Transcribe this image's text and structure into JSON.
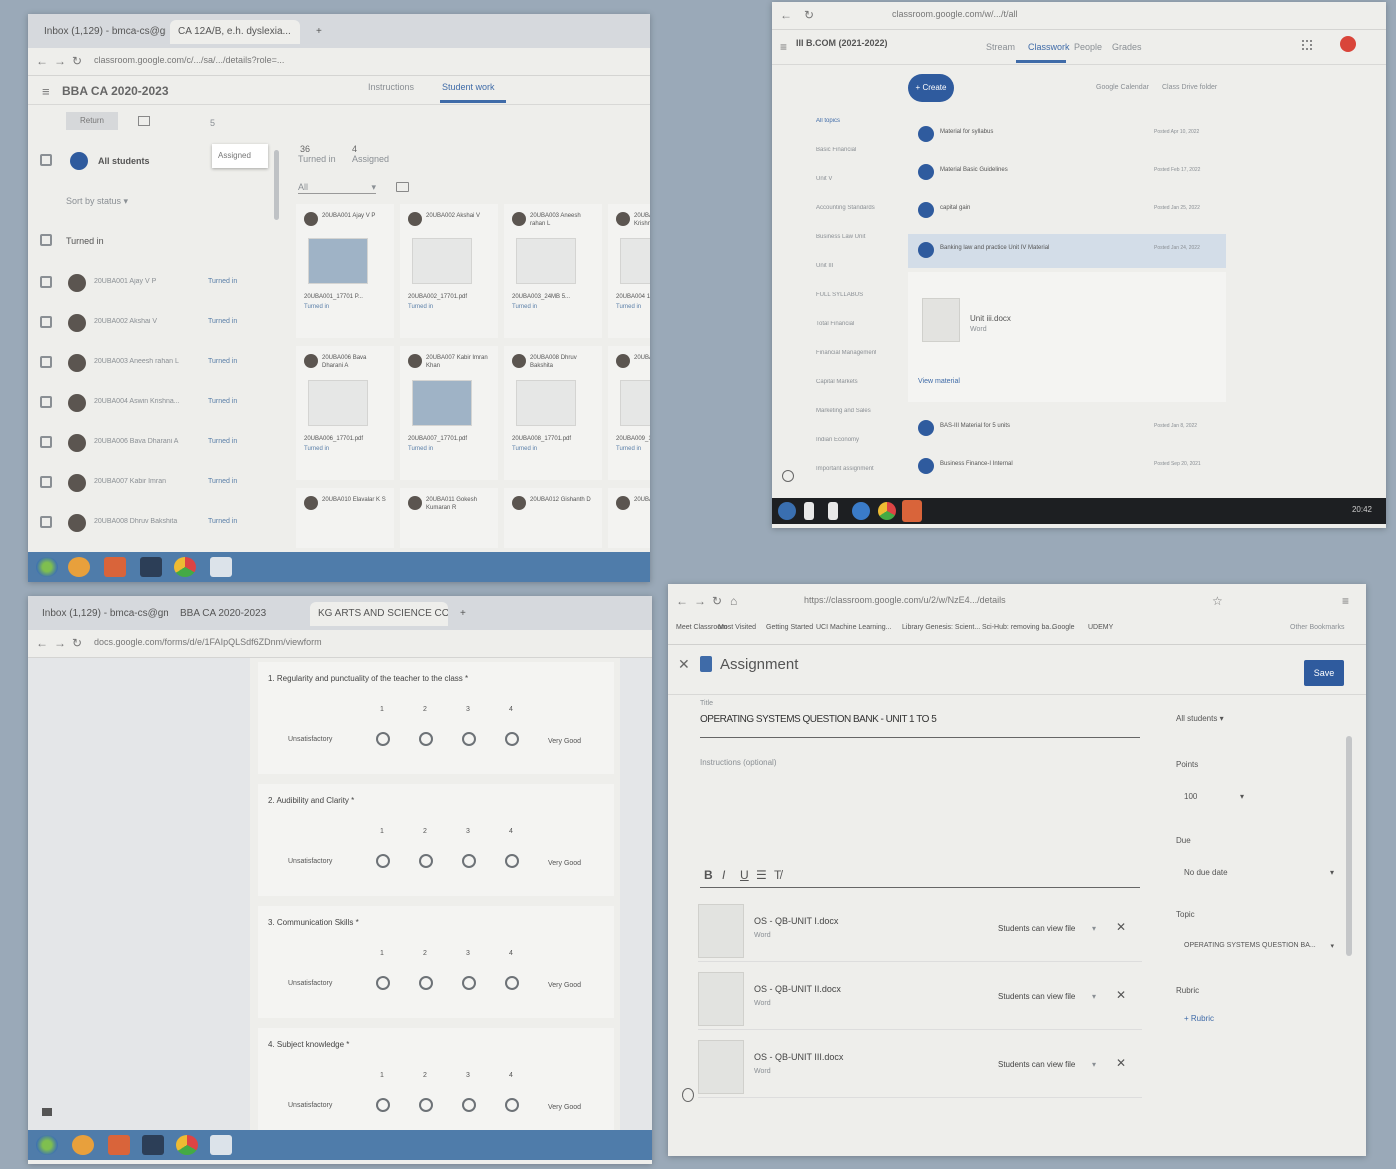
{
  "w1": {
    "tabs": [
      "Inbox (1,129) - bmca-cs@gm...",
      "CA 12A/B, e.h. dyslexia...",
      "+"
    ],
    "url": "classroom.google.com/c/.../sa/.../details?role=...",
    "class_title": "BBA CA 2020-2023",
    "tabs_nav": [
      "Instructions",
      "Student work"
    ],
    "return_label": "Return",
    "assigned_badge": "Assigned",
    "all_students": "All students",
    "sort_label": "Sort by status",
    "turned_in_group": "Turned in",
    "counts": {
      "turned_label": "Turned in",
      "assigned_label": "Assigned",
      "turned_count": "36",
      "assigned_count": "4"
    },
    "filter_all": "All",
    "students": [
      {
        "name": "20UBA001 Ajay V P",
        "status": "Turned in"
      },
      {
        "name": "20UBA002 Akshai V",
        "status": "Turned in"
      },
      {
        "name": "20UBA003 Aneesh rahan L",
        "status": "Turned in"
      },
      {
        "name": "20UBA004 Aswin Krishna...",
        "status": "Turned in"
      },
      {
        "name": "20UBA006 Bava Dharani A",
        "status": "Turned in"
      },
      {
        "name": "20UBA007 Kabir Imran",
        "status": "Turned in"
      },
      {
        "name": "20UBA008 Dhruv Bakshita",
        "status": "Turned in"
      }
    ],
    "grid": [
      {
        "name": "20UBA001 Ajay V P",
        "file": "20UBA001_17701 P...",
        "status": "Turned in"
      },
      {
        "name": "20UBA002 Akshai V",
        "file": "20UBA002_17701.pdf",
        "status": "Turned in"
      },
      {
        "name": "20UBA003 Aneesh rahan L",
        "file": "20UBA003_24MB 5...",
        "status": "Turned in"
      },
      {
        "name": "20UBA004 Aravindha Krishnan M",
        "file": "20UBA004 17701.pdf",
        "status": "Turned in"
      },
      {
        "name": "20UBA006 Bava Dharani A",
        "file": "20UBA006_17701.pdf",
        "status": "Turned in"
      },
      {
        "name": "20UBA007 Kabir Imran Khan",
        "file": "20UBA007_17701.pdf",
        "status": "Turned in"
      },
      {
        "name": "20UBA008 Dhruv Bakshita",
        "file": "20UBA008_17701.pdf",
        "status": "Turned in"
      },
      {
        "name": "20UBA009 Elanzhezi N",
        "file": "20UBA009_177001",
        "status": "Turned in"
      },
      {
        "name": "20UBA010 Elavalar K S",
        "file": "",
        "status": ""
      },
      {
        "name": "20UBA011 Gokesh Kumaran R",
        "file": "",
        "status": ""
      },
      {
        "name": "20UBA012 Gishanth D",
        "file": "",
        "status": ""
      },
      {
        "name": "20UBA013 Gitiya V",
        "file": "",
        "status": ""
      }
    ]
  },
  "w2": {
    "url": "classroom.google.com/w/.../t/all",
    "class_title": "III B.COM (2021-2022)",
    "nav": [
      "Stream",
      "Classwork",
      "People",
      "Grades"
    ],
    "create_label": "+ Create",
    "calendar_label": "Google Calendar",
    "drive_label": "Class Drive folder",
    "topics": [
      "All topics",
      "Basic Financial",
      "Unit V",
      "Accounting Standards",
      "Business Law Unit",
      "Unit III",
      "FULL SYLLABUS",
      "Total Financial",
      "Financial Management",
      "Capital Markets",
      "Marketing and Sales",
      "Indian Economy",
      "Important assignment"
    ],
    "items": [
      {
        "title": "Material for syllabus",
        "date": "Posted Apr 10, 2022"
      },
      {
        "title": "Material Basic Guidelines",
        "date": "Posted Feb 17, 2022"
      },
      {
        "title": "capital gain",
        "date": "Posted Jan 25, 2022"
      },
      {
        "title": "Banking law and practice Unit IV Material",
        "date": "Posted Jan 24, 2022"
      }
    ],
    "expanded_file": {
      "name": "Unit iii.docx",
      "type": "Word"
    },
    "view_material": "View material",
    "more_items": [
      {
        "title": "BAS-III Material for 5 units",
        "date": "Posted Jan 8, 2022"
      },
      {
        "title": "Business Finance-I Internal",
        "date": "Posted Sep 20, 2021"
      }
    ],
    "clock": "20:42"
  },
  "w3": {
    "tabs": [
      "Inbox (1,129) - bmca-cs@gm...",
      "BBA CA 2020-2023",
      "KG ARTS AND SCIENCE CO...",
      "+"
    ],
    "url": "docs.google.com/forms/d/e/1FAIpQLSdf6ZDnm/viewform",
    "questions": [
      {
        "title": "1. Regularity and punctuality of the teacher to the class *",
        "scale": [
          "1",
          "2",
          "3",
          "4"
        ],
        "low": "Unsatisfactory",
        "high": "Very Good"
      },
      {
        "title": "2. Audibility and Clarity *",
        "scale": [
          "1",
          "2",
          "3",
          "4"
        ],
        "low": "Unsatisfactory",
        "high": "Very Good"
      },
      {
        "title": "3. Communication Skills *",
        "scale": [
          "1",
          "2",
          "3",
          "4"
        ],
        "low": "Unsatisfactory",
        "high": "Very Good"
      },
      {
        "title": "4. Subject knowledge *",
        "scale": [
          "1",
          "2",
          "3",
          "4"
        ],
        "low": "Unsatisfactory",
        "high": "Very Good"
      }
    ]
  },
  "w4": {
    "url": "https://classroom.google.com/u/2/w/NzE4.../details",
    "bookmarks": [
      "Meet Classroom",
      "Most Visited",
      "Getting Started",
      "UCI Machine Learning...",
      "Library Genesis: Scient...",
      "Sci-Hub: removing ba...",
      "Google",
      "UDEMY"
    ],
    "other_bookmarks": "Other Bookmarks",
    "page_title": "Assignment",
    "save_label": "Save",
    "title_label": "Title",
    "title_value": "OPERATING SYSTEMS QUESTION BANK - UNIT 1 TO 5",
    "instructions_placeholder": "Instructions (optional)",
    "format": [
      "B",
      "I",
      "U",
      "☰",
      "T̸"
    ],
    "attachments": [
      {
        "name": "OS - QB-UNIT I.docx",
        "type": "Word",
        "perm": "Students can view file"
      },
      {
        "name": "OS - QB-UNIT II.docx",
        "type": "Word",
        "perm": "Students can view file"
      },
      {
        "name": "OS - QB-UNIT III.docx",
        "type": "Word",
        "perm": "Students can view file"
      }
    ],
    "for_value": "All students",
    "points_label": "Points",
    "points_value": "100",
    "due_label": "Due",
    "due_value": "No due date",
    "topic_label": "Topic",
    "topic_value": "OPERATING SYSTEMS QUESTION BA...",
    "rubric_label": "Rubric",
    "rubric_button": "+ Rubric"
  },
  "colors": {
    "taskbar": "#4f7caa",
    "classroom_blue": "#2f5b9e",
    "background": "#eeeeeb"
  }
}
